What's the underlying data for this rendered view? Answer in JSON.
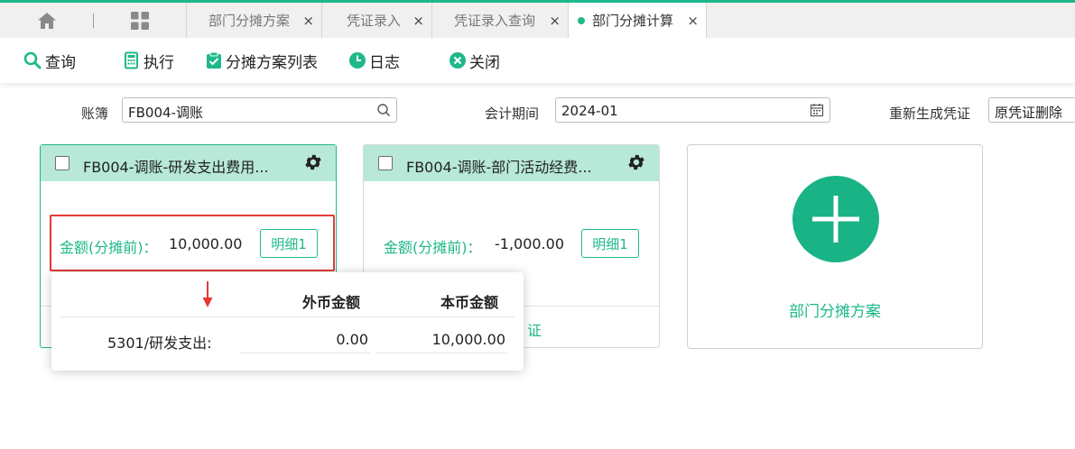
{
  "tabs": [
    {
      "label": "部门分摊方案"
    },
    {
      "label": "凭证录入"
    },
    {
      "label": "凭证录入查询"
    },
    {
      "label": "部门分摊计算",
      "active": true
    }
  ],
  "tab_close_glyph": "×",
  "toolbar": {
    "query": "查询",
    "execute": "执行",
    "scheme_list": "分摊方案列表",
    "log": "日志",
    "close": "关闭"
  },
  "filters": {
    "book_label": "账簿",
    "book_value": "FB004-调账",
    "period_label": "会计期间",
    "period_value": "2024-01",
    "regen_label": "重新生成凭证",
    "regen_value": "原凭证删除"
  },
  "cards": [
    {
      "title": "FB004-调账-研发支出费用...",
      "amount_label": "金额(分摊前)：",
      "amount": "10,000.00",
      "detail": "明细1"
    },
    {
      "title": "FB004-调账-部门活动经费...",
      "amount_label": "金额(分摊前)：",
      "amount": "-1,000.00",
      "detail": "明细1",
      "footer_partial": "证"
    }
  ],
  "popup": {
    "col_foreign": "外币金额",
    "col_local": "本币金额",
    "rows": [
      {
        "account": "5301/研发支出:",
        "foreign": "0.00",
        "local": "10,000.00"
      }
    ]
  },
  "add_card": {
    "label": "部门分摊方案"
  },
  "colors": {
    "accent": "#1fb88a",
    "card_header": "#b7e8d8",
    "highlight": "#e53935"
  },
  "icons": [
    "home-icon",
    "grid-icon",
    "search-icon",
    "calculator-icon",
    "clipboard-icon",
    "clock-icon",
    "close-circle-icon",
    "calendar-icon",
    "gear-icon",
    "plus-icon",
    "arrow-down-icon"
  ]
}
